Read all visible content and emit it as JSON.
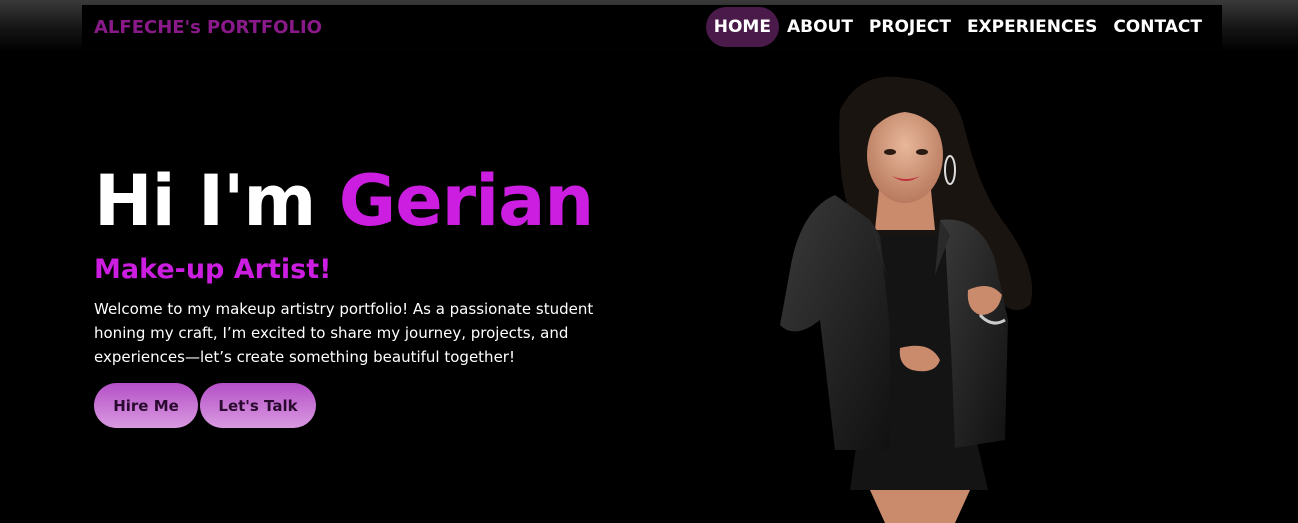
{
  "header": {
    "brand": "ALFECHE's PORTFOLIO",
    "nav": [
      {
        "label": "HOME",
        "active": true
      },
      {
        "label": "ABOUT",
        "active": false
      },
      {
        "label": "PROJECT",
        "active": false
      },
      {
        "label": "EXPERIENCES",
        "active": false
      },
      {
        "label": "CONTACT",
        "active": false
      }
    ]
  },
  "hero": {
    "greeting": "Hi I'm ",
    "name": "Gerian",
    "role": "Make-up Artist!",
    "description": "Welcome to my makeup artistry portfolio! As a passionate student honing my craft, I’m excited to share my journey, projects, and experiences—let’s create something beautiful together!",
    "buttons": {
      "hire": "Hire Me",
      "talk": "Let's Talk"
    }
  },
  "colors": {
    "accent": "#cc1ee0",
    "brand": "#8a1a8a",
    "active_nav_bg": "#4a1a4a",
    "background": "#000000"
  }
}
